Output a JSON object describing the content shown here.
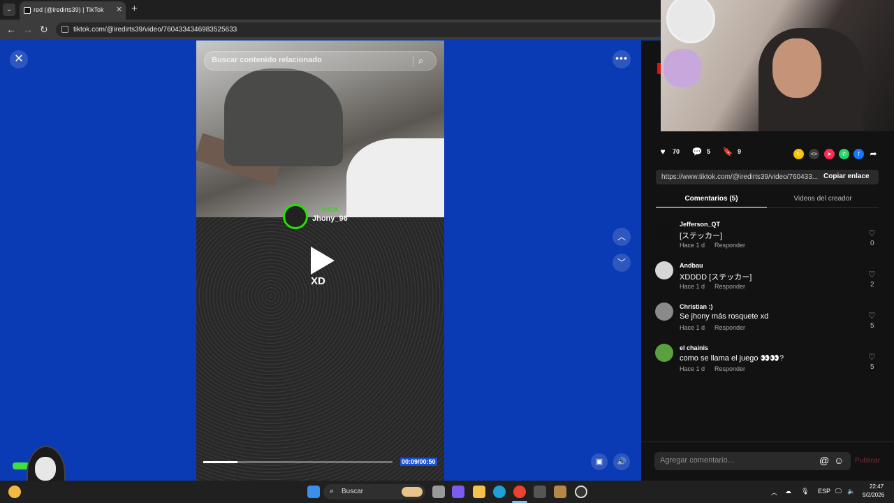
{
  "browser": {
    "tab_title": "red (@iredirts39) | TikTok",
    "url": "tiktok.com/@iredirts39/video/7604334346983525633"
  },
  "video": {
    "search_placeholder": "Buscar contenido relacionado",
    "kick_label": "KICK",
    "kick_user": "Jhony_96",
    "caption": "XD",
    "time": "00:09/00:50",
    "progress": 0.18
  },
  "actions": {
    "likes": "70",
    "comments": "5",
    "saves": "9"
  },
  "share": {
    "link": "https://www.tiktok.com/@iredirts39/video/760433...",
    "copy_label": "Copiar enlace"
  },
  "tabs": {
    "comments": "Comentarios (5)",
    "creator_videos": "Videos del creador"
  },
  "comments": [
    {
      "user": "Jefferson_QT",
      "text": "[ステッカー]",
      "time": "Hace 1 d",
      "reply": "Responder",
      "likes": "0",
      "avatar_color": "#111111"
    },
    {
      "user": "Andbau",
      "text": "XDDDD [ステッカー]",
      "time": "Hace 1 d",
      "reply": "Responder",
      "likes": "2",
      "avatar_color": "#d7d7d7"
    },
    {
      "user": "Christian :)",
      "text": "Se jhony más rosquete xd",
      "time": "Hace 1 d",
      "reply": "Responder",
      "likes": "5",
      "avatar_color": "#8a8a8a"
    },
    {
      "user": "el chainis",
      "text": "como se llama el juego 👀👀?",
      "time": "Hace 1 d",
      "reply": "Responder",
      "likes": "5",
      "avatar_color": "#5aa040"
    }
  ],
  "composer": {
    "placeholder": "Agregar comentario...",
    "publish": "Publicar"
  },
  "taskbar": {
    "search_label": "Buscar",
    "lang": "ESP",
    "time": "22:47",
    "date": "9/2/2026"
  },
  "colors": {
    "page_bg": "#0a3bb5",
    "panel_bg": "#121212",
    "accent_red": "#fe2c55",
    "kick_green": "#26e000"
  }
}
